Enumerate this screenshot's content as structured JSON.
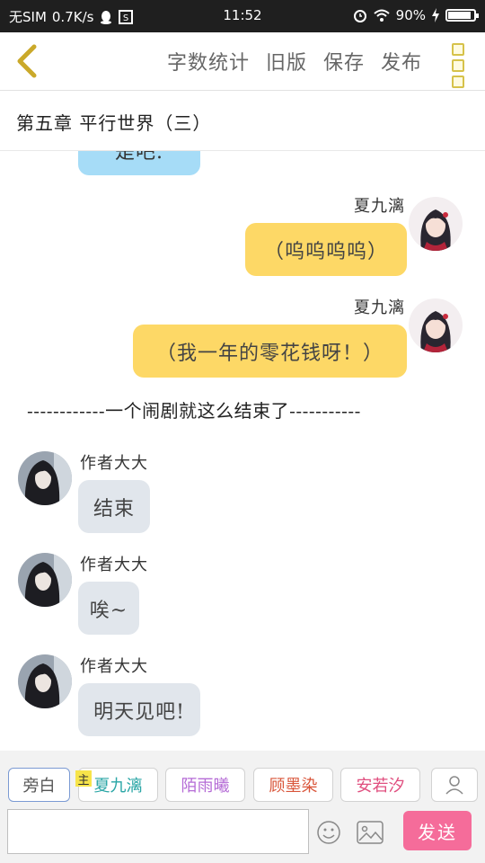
{
  "status": {
    "carrier": "无SIM",
    "speed": "0.7K/s",
    "time": "11:52",
    "battery": "90%",
    "battery_level": 0.9
  },
  "toolbar": {
    "back_icon": "chevron-left-icon",
    "actions": [
      "字数统计",
      "旧版",
      "保存",
      "发布"
    ],
    "more_icon": "vertical-dots-icon"
  },
  "chapter": {
    "title": "第五章 平行世界（三）"
  },
  "chat": {
    "partial_message": "是吧.",
    "messages": [
      {
        "sender": "夏九漓",
        "text": "（呜呜呜呜）"
      },
      {
        "sender": "夏九漓",
        "text": "（我一年的零花钱呀！）"
      },
      {
        "sender": "作者大大",
        "text": "结束"
      },
      {
        "sender": "作者大大",
        "text": "唉~"
      },
      {
        "sender": "作者大大",
        "text": "明天见吧!"
      }
    ],
    "narration": "------------一个闹剧就这么结束了-----------"
  },
  "roles": {
    "items": [
      "旁白",
      "夏九漓",
      "陌雨曦",
      "顾墨染",
      "安若汐"
    ],
    "main_badge": "主",
    "colors": [
      "#555555",
      "#2aa6a6",
      "#b56bd6",
      "#d9553a",
      "#e04f7f"
    ]
  },
  "input": {
    "placeholder": "",
    "send_label": "发送",
    "accent": "#f56c9a"
  }
}
